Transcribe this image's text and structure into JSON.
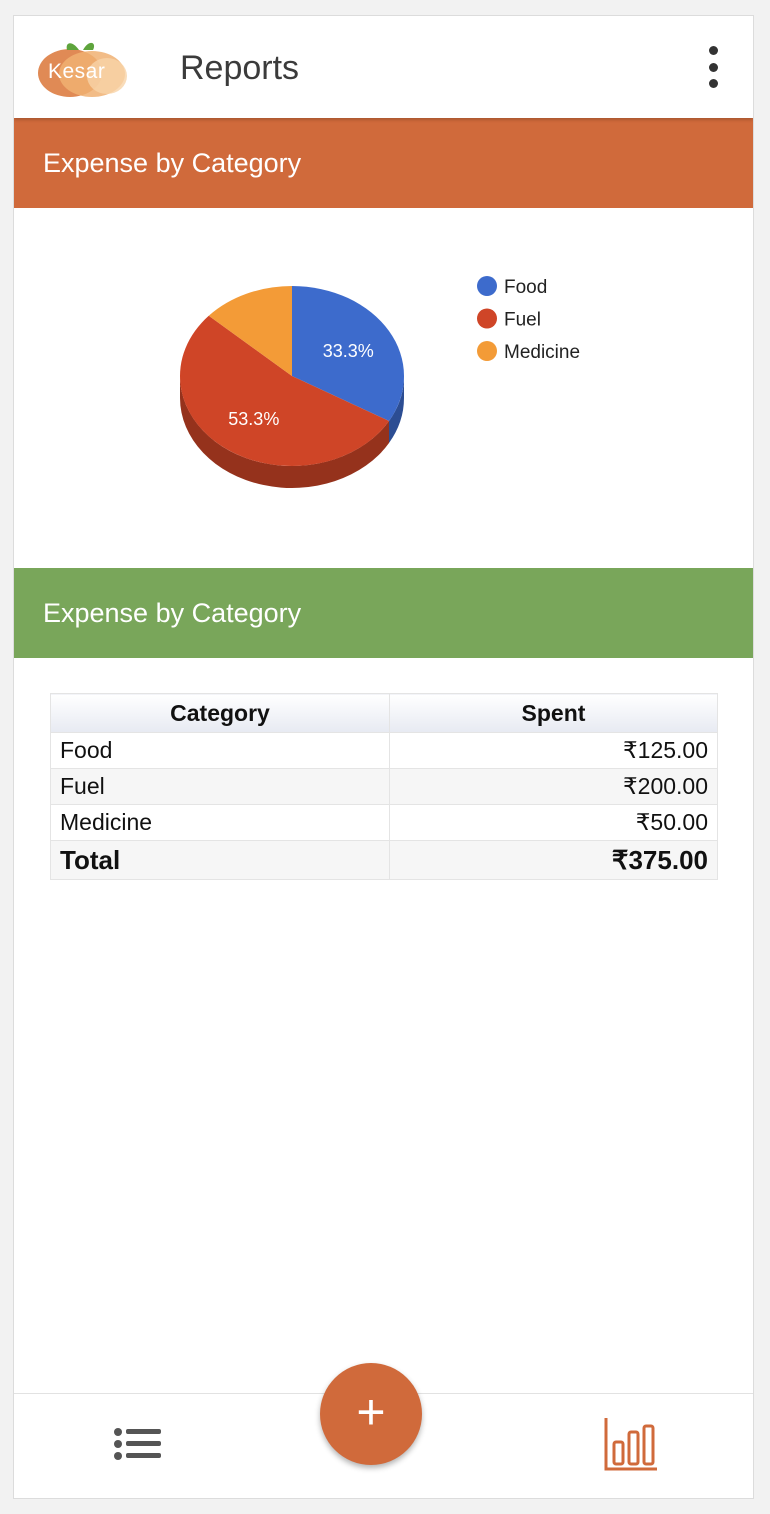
{
  "app": {
    "logo_text": "Kesar",
    "title": "Reports"
  },
  "pie_section": {
    "title": "Expense by Category"
  },
  "table_section": {
    "title": "Expense by Category"
  },
  "chart_data": {
    "type": "pie",
    "slices": [
      {
        "label": "Food",
        "value": 125,
        "percent": 33.3,
        "percent_label": "33.3%",
        "color": "#3d6bcc"
      },
      {
        "label": "Fuel",
        "value": 200,
        "percent": 53.3,
        "percent_label": "53.3%",
        "color": "#cf4527"
      },
      {
        "label": "Medicine",
        "value": 50,
        "percent": 13.3,
        "percent_label": "",
        "color": "#f39b37"
      }
    ],
    "legend_position": "right",
    "three_d": true
  },
  "table": {
    "headers": [
      "Category",
      "Spent"
    ],
    "rows": [
      {
        "category": "Food",
        "spent": "₹125.00"
      },
      {
        "category": "Fuel",
        "spent": "₹200.00"
      },
      {
        "category": "Medicine",
        "spent": "₹50.00"
      }
    ],
    "total": {
      "label": "Total",
      "value": "₹375.00"
    }
  },
  "nav": {
    "fab_label": "+",
    "list_icon": "list-icon",
    "chart_icon": "bar-chart-icon",
    "accent": "#d06a3b"
  }
}
